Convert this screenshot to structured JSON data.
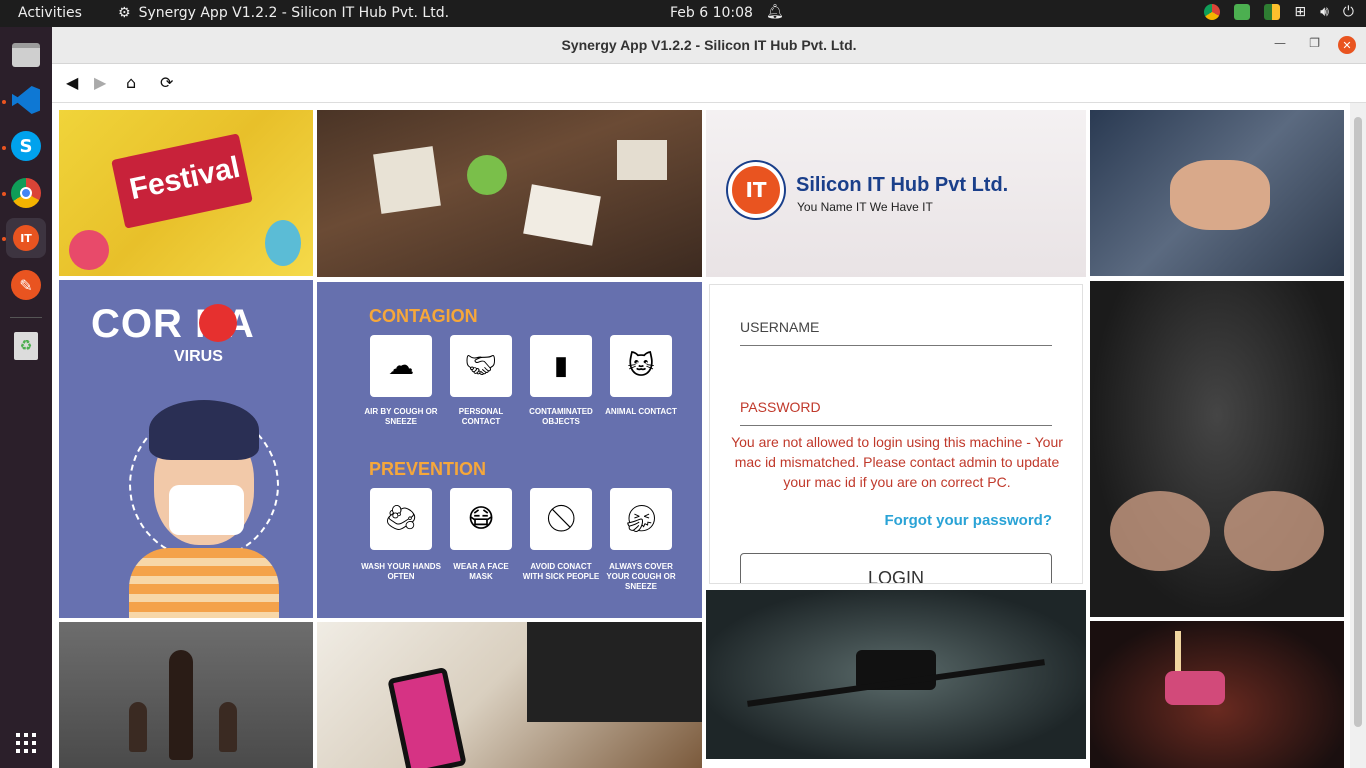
{
  "topbar": {
    "activities": "Activities",
    "app_name": "Synergy App V1.2.2 - Silicon IT Hub Pvt. Ltd.",
    "clock": "Feb 6  10:08"
  },
  "dock": {
    "items": [
      "files",
      "vscode",
      "skype",
      "chrome",
      "synergy",
      "tool",
      "trash"
    ]
  },
  "window": {
    "title": "Synergy App V1.2.2 - Silicon IT Hub Pvt. Ltd."
  },
  "tiles": {
    "festival_text": "Festival",
    "brand_name": "Silicon IT Hub Pvt Ltd.",
    "brand_tagline": "You Name IT We Have IT",
    "logo_text": "IT",
    "corona_title": "COR NA",
    "corona_sub": "VIRUS",
    "contagion_title": "CONTAGION",
    "contagion_items": [
      "AIR BY COUGH OR SNEEZE",
      "PERSONAL CONTACT",
      "CONTAMINATED OBJECTS",
      "ANIMAL CONTACT"
    ],
    "prevention_title": "PREVENTION",
    "prevention_items": [
      "WASH YOUR HANDS OFTEN",
      "WEAR A FACE MASK",
      "AVOID CONACT WITH SICK PEOPLE",
      "ALWAYS COVER YOUR COUGH OR SNEEZE"
    ]
  },
  "login": {
    "username_label": "USERNAME",
    "password_label": "PASSWORD",
    "error": "You are not allowed to login using this machine - Your mac id mismatched. Please contact admin to update your mac id if you are on correct PC.",
    "forgot": "Forgot your password?",
    "button": "LOGIN"
  },
  "colors": {
    "accent": "#e95420",
    "error": "#c0392b",
    "link": "#2aa3d6",
    "contagion_bg": "#6670ae"
  }
}
